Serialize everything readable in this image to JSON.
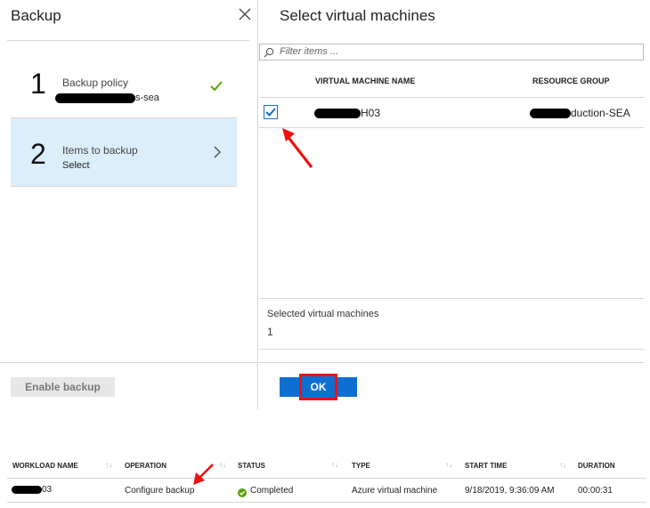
{
  "backup_panel": {
    "title": "Backup",
    "steps": [
      {
        "number": "1",
        "title": "Backup policy",
        "subtitle_suffix": "s-sea",
        "status": "complete"
      },
      {
        "number": "2",
        "title": "Items to backup",
        "subtitle": "Select"
      }
    ],
    "enable_backup_label": "Enable backup"
  },
  "vm_panel": {
    "title": "Select virtual machines",
    "filter_placeholder": "Filter items ...",
    "columns": [
      "VIRTUAL MACHINE NAME",
      "RESOURCE GROUP"
    ],
    "rows": [
      {
        "checked": true,
        "vm_name_suffix": "H03",
        "resource_group_suffix": "duction-SEA"
      }
    ],
    "selected_label": "Selected virtual machines",
    "selected_count": "1",
    "ok_label": "OK"
  },
  "jobs_table": {
    "columns": [
      "WORKLOAD NAME",
      "OPERATION",
      "STATUS",
      "TYPE",
      "START TIME",
      "DURATION"
    ],
    "row": {
      "workload_suffix": "03",
      "operation": "Configure backup",
      "status": "Completed",
      "type": "Azure virtual machine",
      "start_time": "9/18/2019, 9:36:09 AM",
      "duration": "00:00:31"
    }
  },
  "colors": {
    "accent": "#0f6fd1",
    "highlight": "#e11",
    "selected_bg": "#dbeefc",
    "success": "#57a300"
  }
}
